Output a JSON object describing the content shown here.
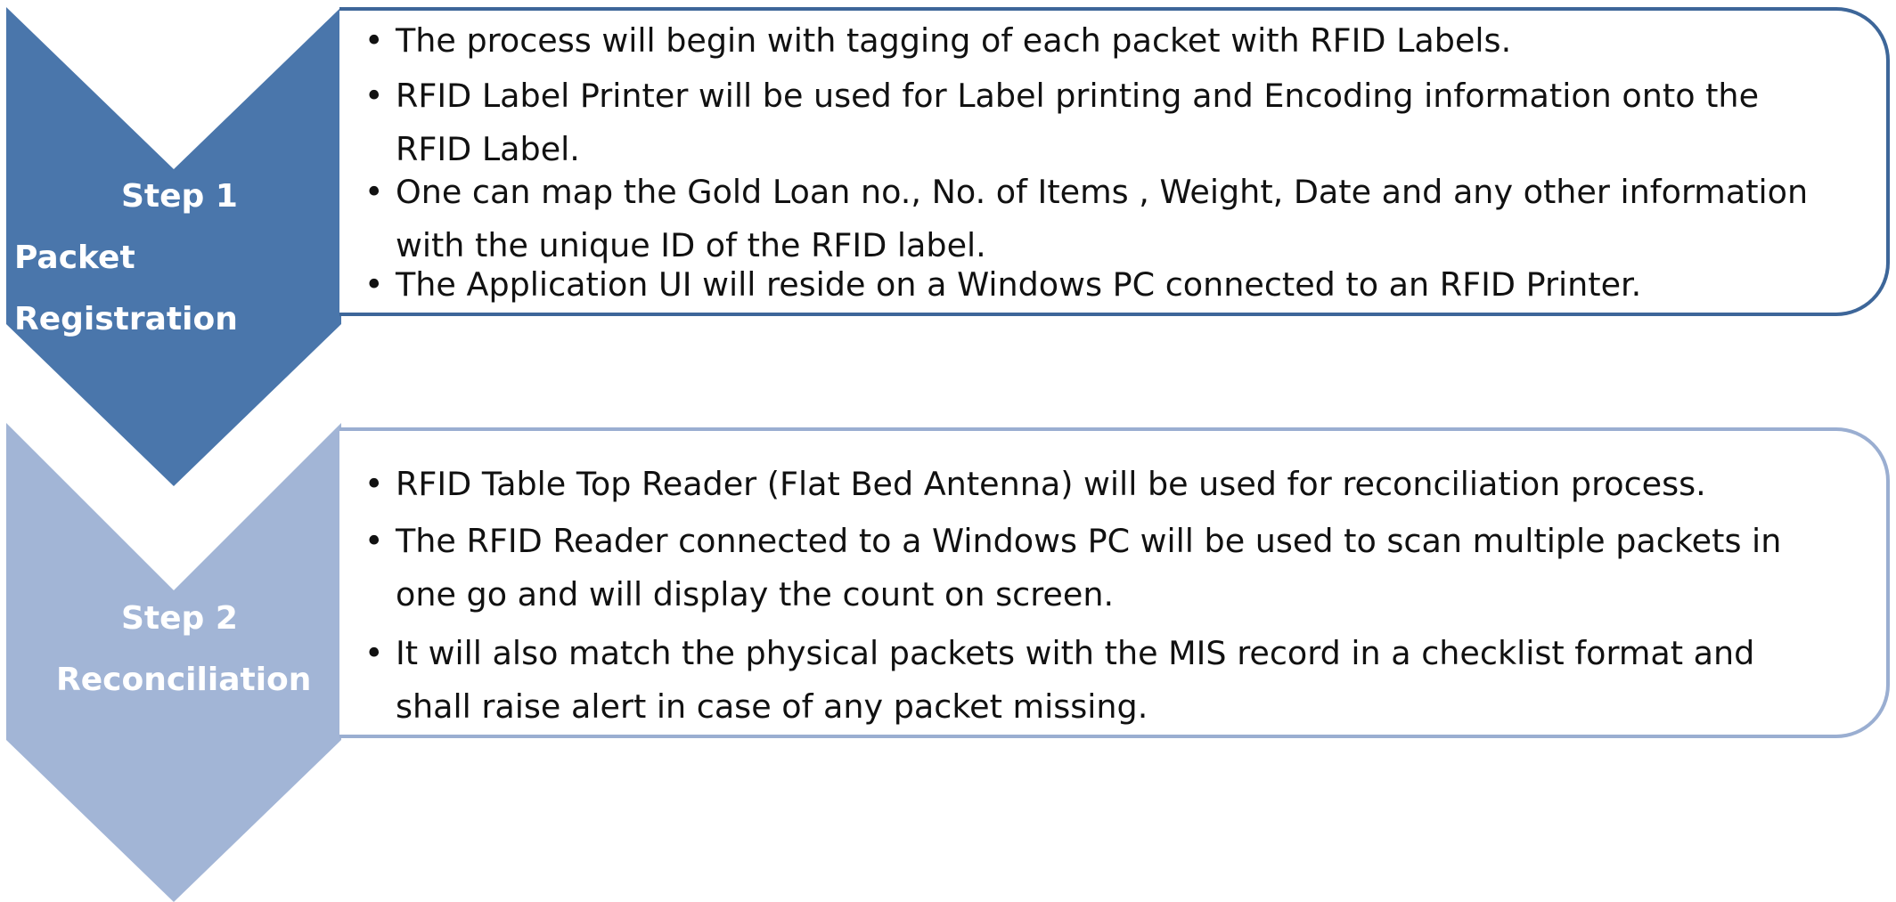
{
  "colors": {
    "step1": "#4a76ab",
    "step1_border": "#3d6699",
    "step2": "#a2b5d6",
    "step2_border": "#9aaed1"
  },
  "steps": [
    {
      "number_label": "Step 1",
      "title_lines": [
        "Packet",
        "Registration"
      ],
      "bullets": [
        "The process will begin with tagging of each packet with RFID Labels.",
        "RFID Label Printer will be used for Label printing and Encoding information onto the RFID Label.",
        "One can map the Gold Loan no., No. of Items , Weight, Date and any other information with the unique ID of the RFID label.",
        "The Application UI will reside on a Windows PC connected to an RFID Printer."
      ]
    },
    {
      "number_label": "Step 2",
      "title_lines": [
        "Reconciliation"
      ],
      "bullets": [
        "RFID Table Top Reader (Flat Bed Antenna) will be used for reconciliation process.",
        "The RFID Reader connected to a Windows PC will be used to scan multiple packets in one go and will display the count on screen.",
        "It will also match the physical packets with the MIS record in a checklist format and shall raise alert in case of any packet missing."
      ]
    }
  ],
  "bullet_glyph": "•"
}
